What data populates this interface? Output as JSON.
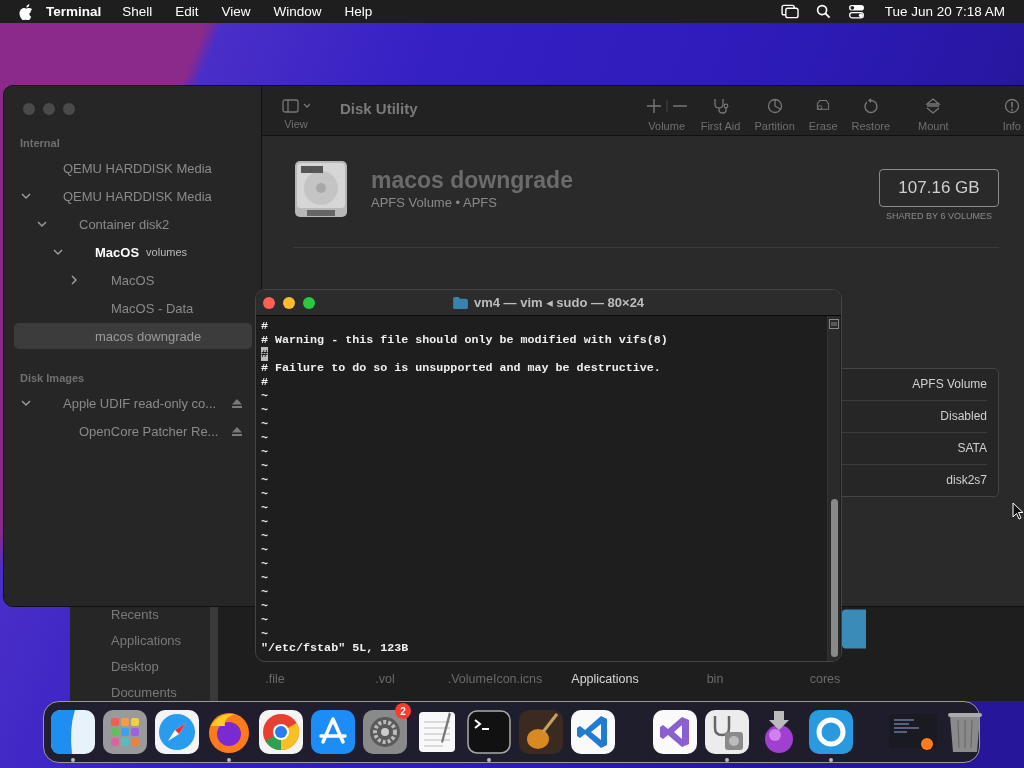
{
  "menu_bar": {
    "app": "Terminal",
    "menus": [
      "Shell",
      "Edit",
      "View",
      "Window",
      "Help"
    ],
    "clock": "Tue Jun 20 7:18 AM"
  },
  "finder": {
    "sidebar": [
      "Recents",
      "Applications",
      "Desktop",
      "Documents"
    ],
    "files": [
      {
        "name": ".file",
        "selected": false
      },
      {
        "name": ".vol",
        "selected": false
      },
      {
        "name": ".VolumeIcon.icns",
        "selected": false
      },
      {
        "name": "Applications",
        "selected": true
      },
      {
        "name": "bin",
        "selected": false
      },
      {
        "name": "cores",
        "selected": false,
        "icon_shown": true
      }
    ]
  },
  "disk_utility": {
    "view_label": "View",
    "title": "Disk Utility",
    "toolbar": [
      {
        "kind": "volume",
        "label": "Volume"
      },
      {
        "kind": "first_aid",
        "label": "First Aid"
      },
      {
        "kind": "partition",
        "label": "Partition"
      },
      {
        "kind": "erase",
        "label": "Erase"
      },
      {
        "kind": "restore",
        "label": "Restore"
      },
      {
        "kind": "mount",
        "label": "Mount"
      },
      {
        "kind": "info",
        "label": "Info"
      }
    ],
    "sidebar": [
      {
        "heading": "Internal",
        "items": [
          {
            "label": "QEMU HARDDISK Media",
            "kind": "device",
            "selected": false
          },
          {
            "label": "QEMU HARDDISK Media",
            "kind": "device",
            "expanded": true,
            "selected": false,
            "children": [
              {
                "label": "Container disk2",
                "kind": "device",
                "expanded": true,
                "selected": false,
                "children": [
                  {
                    "label": "MacOS",
                    "note": "volumes",
                    "kind": "group",
                    "expanded": true,
                    "selected": false,
                    "children": [
                      {
                        "label": "MacOS",
                        "kind": "device",
                        "expanded": false,
                        "selected": false
                      },
                      {
                        "label": "MacOS - Data",
                        "kind": "device",
                        "selected": false
                      }
                    ]
                  },
                  {
                    "label": "macos downgrade",
                    "kind": "device",
                    "selected": true
                  }
                ]
              }
            ]
          }
        ]
      },
      {
        "heading": "Disk Images",
        "items": [
          {
            "label": "Apple UDIF read-only co...",
            "kind": "device",
            "expanded": true,
            "selected": false,
            "ejectable": true,
            "children": [
              {
                "label": "OpenCore Patcher Re...",
                "kind": "device",
                "selected": false,
                "ejectable": true
              }
            ]
          }
        ]
      }
    ],
    "volume": {
      "name": "macos downgrade",
      "subtitle": "APFS Volume • APFS",
      "capacity": "107.16 GB",
      "capacity_note": "SHARED BY 6 VOLUMES"
    },
    "details": [
      "APFS Volume",
      "Disabled",
      "SATA",
      "disk2s7"
    ]
  },
  "terminal": {
    "title": "vm4 — vim ◂ sudo — 80×24",
    "lines": [
      {
        "text": "#",
        "cursor": false
      },
      {
        "text": "# Warning - this file should only be modified with vifs(8)",
        "cursor": false
      },
      {
        "text": "#",
        "cursor": true
      },
      {
        "text": "# Failure to do so is unsupported and may be destructive.",
        "cursor": false
      },
      {
        "text": "#",
        "cursor": false
      },
      {
        "text": "~",
        "cursor": false
      },
      {
        "text": "~",
        "cursor": false
      },
      {
        "text": "~",
        "cursor": false
      },
      {
        "text": "~",
        "cursor": false
      },
      {
        "text": "~",
        "cursor": false
      },
      {
        "text": "~",
        "cursor": false
      },
      {
        "text": "~",
        "cursor": false
      },
      {
        "text": "~",
        "cursor": false
      },
      {
        "text": "~",
        "cursor": false
      },
      {
        "text": "~",
        "cursor": false
      },
      {
        "text": "~",
        "cursor": false
      },
      {
        "text": "~",
        "cursor": false
      },
      {
        "text": "~",
        "cursor": false
      },
      {
        "text": "~",
        "cursor": false
      },
      {
        "text": "~",
        "cursor": false
      },
      {
        "text": "~",
        "cursor": false
      },
      {
        "text": "~",
        "cursor": false
      },
      {
        "text": "~",
        "cursor": false
      }
    ],
    "status": "\"/etc/fstab\" 5L, 123B"
  },
  "dock": [
    {
      "kind": "finder",
      "running": true
    },
    {
      "kind": "launchpad",
      "running": false
    },
    {
      "kind": "safari",
      "running": false
    },
    {
      "kind": "firefox",
      "running": true
    },
    {
      "kind": "chrome",
      "running": false
    },
    {
      "kind": "appstore",
      "running": false
    },
    {
      "kind": "settings",
      "running": false,
      "badge": "2"
    },
    {
      "kind": "textedit",
      "running": false
    },
    {
      "kind": "terminal",
      "running": true
    },
    {
      "kind": "garageband",
      "running": false
    },
    {
      "kind": "vscode",
      "running": false
    },
    {
      "kind": "separator"
    },
    {
      "kind": "visualstudio",
      "running": false
    },
    {
      "kind": "diskutility",
      "running": true
    },
    {
      "kind": "installer",
      "running": false
    },
    {
      "kind": "ringapp",
      "running": true
    },
    {
      "kind": "separator"
    },
    {
      "kind": "window",
      "running": false
    },
    {
      "kind": "trash",
      "running": false
    }
  ]
}
